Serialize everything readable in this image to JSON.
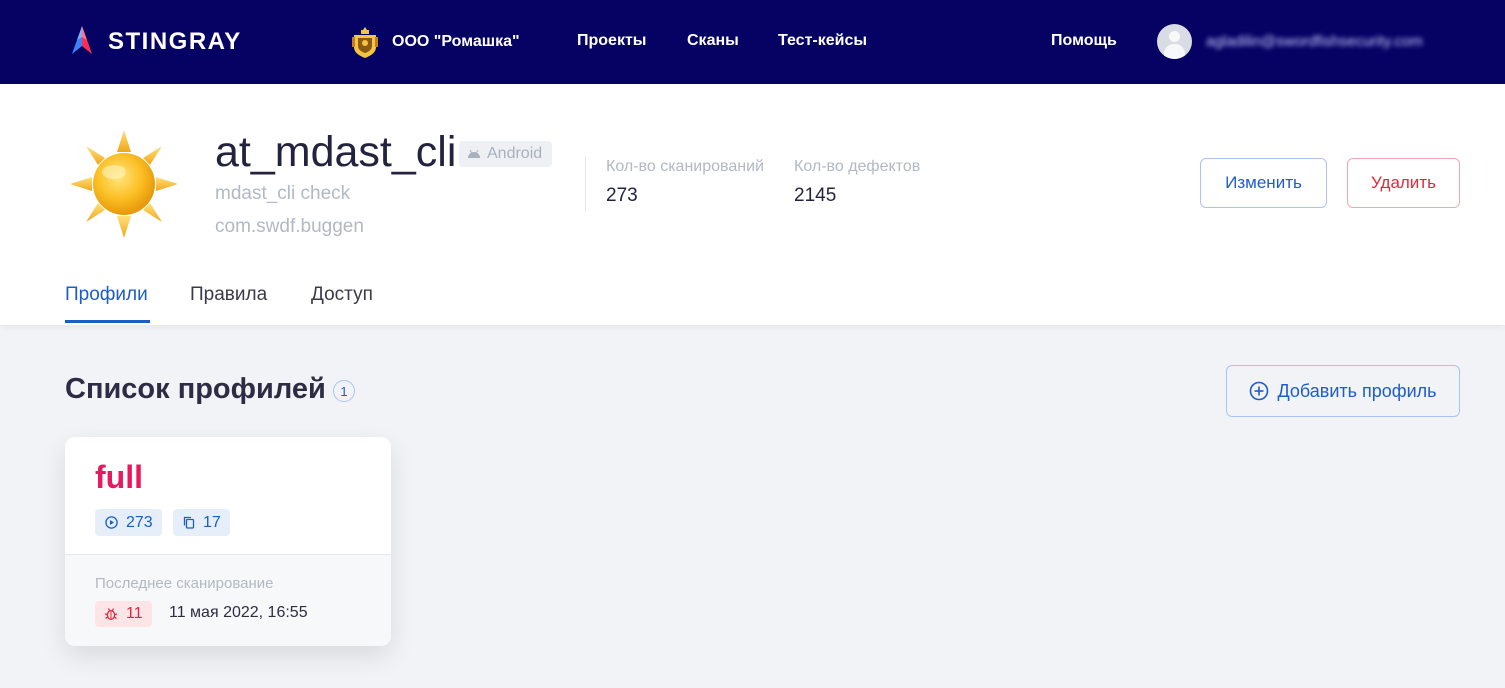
{
  "topbar": {
    "brand": "STINGRAY",
    "organization": "ООО \"Ромашка\"",
    "nav": [
      "Проекты",
      "Сканы",
      "Тест-кейсы"
    ],
    "help": "Помощь",
    "user_email": "agladilin@swordfishsecurity.com"
  },
  "project": {
    "title": "at_mdast_cli",
    "platform": "Android",
    "description": "mdast_cli check",
    "package": "com.swdf.buggen",
    "stats": {
      "scans_label": "Кол-во сканирований",
      "scans_value": "273",
      "defects_label": "Кол-во дефектов",
      "defects_value": "2145"
    },
    "buttons": {
      "edit": "Изменить",
      "delete": "Удалить"
    },
    "tabs": [
      "Профили",
      "Правила",
      "Доступ"
    ],
    "active_tab": "Профили"
  },
  "profiles": {
    "title": "Список профилей",
    "count": "1",
    "add_button": "Добавить профиль",
    "items": [
      {
        "name": "full",
        "scans": "273",
        "copies": "17",
        "last_scan_label": "Последнее сканирование",
        "bugs": "11",
        "last_scan_date": "11 мая 2022, 16:55"
      }
    ]
  },
  "colors": {
    "topbar": "#050264",
    "accent": "#1c5dc8",
    "danger": "#e2283a",
    "profile_name": "#e8195f"
  }
}
